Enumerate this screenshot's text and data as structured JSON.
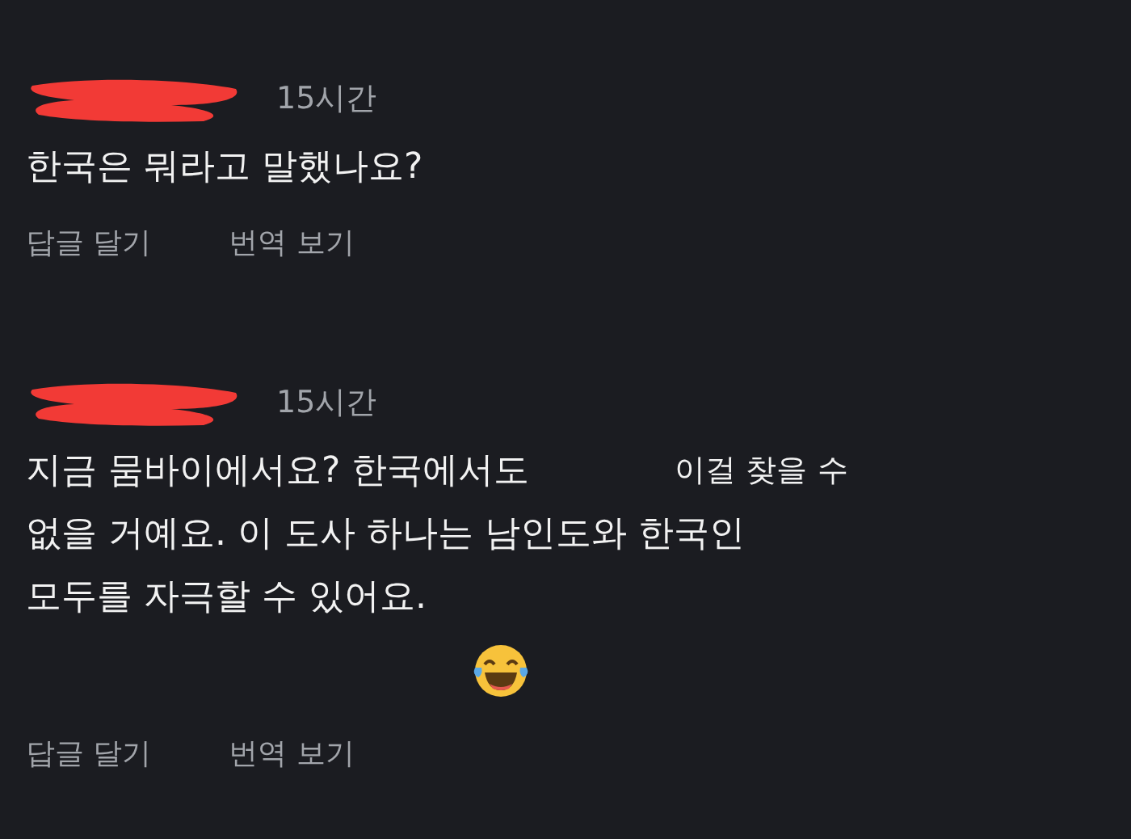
{
  "comments": [
    {
      "time": "15시간",
      "lines": [
        [
          "한국은 뭐라고 말했나요?"
        ]
      ],
      "emoji": false,
      "actions": [
        "답글 달기",
        "번역 보기"
      ]
    },
    {
      "time": "15시간",
      "lines": [
        [
          "지금 뭄바이에서요? 한국에서도",
          "이걸 찾을 수"
        ],
        [
          "없을 거예요. 이 도사 하나는 남인도와 한국인"
        ],
        [
          "모두를 자극할 수 있어요."
        ]
      ],
      "emoji": true,
      "actions": [
        "답글 달기",
        "번역 보기"
      ]
    }
  ]
}
